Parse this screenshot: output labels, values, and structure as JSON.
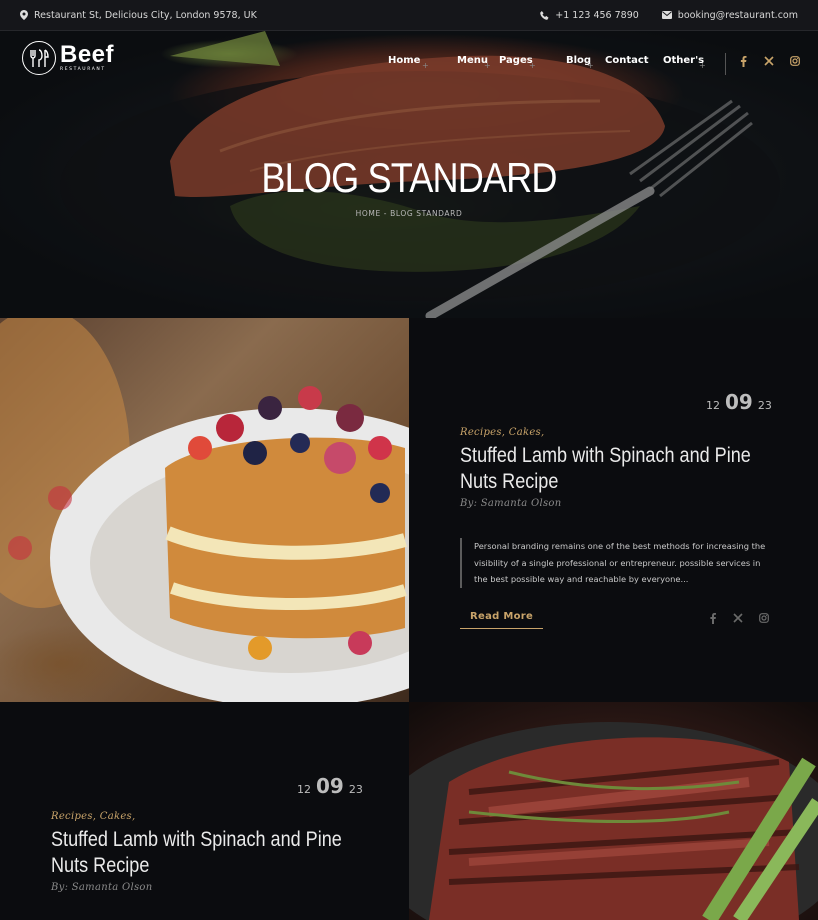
{
  "topbar": {
    "address": "Restaurant St, Delicious City, London 9578, UK",
    "phone": "+1 123 456 7890",
    "email": "booking@restaurant.com",
    "icons": [
      "map-pin-icon",
      "phone-icon",
      "mail-icon"
    ]
  },
  "logo": {
    "brand": "Beef",
    "sub": "RESTAURANT"
  },
  "nav": [
    {
      "label": "Home"
    },
    {
      "label": "Menu"
    },
    {
      "label": "Pages"
    },
    {
      "label": "Blog"
    },
    {
      "label": "Contact"
    },
    {
      "label": "Other's"
    }
  ],
  "social": [
    "facebook-icon",
    "x-icon",
    "instagram-icon"
  ],
  "hero": {
    "title": "BLOG STANDARD",
    "breadcrumb": "HOME - BLOG STANDARD"
  },
  "posts": [
    {
      "day": "12",
      "month": "09",
      "year": "23",
      "categories": "Recipes,  Cakes,",
      "title": "Stuffed Lamb with Spinach and Pine Nuts Recipe",
      "author": "By: Samanta Olson",
      "excerpt": "Personal branding remains one of the best methods for increasing the visibility of a single professional or entrepreneur. possible services in the best possible way and reachable by everyone...",
      "read_more": "Read More"
    },
    {
      "day": "12",
      "month": "09",
      "year": "23",
      "categories": "Recipes,  Cakes,",
      "title": "Stuffed Lamb with Spinach and Pine Nuts Recipe",
      "author": "By: Samanta Olson"
    }
  ],
  "colors": {
    "accent": "#c9a46a",
    "background": "#0b0c0f",
    "topbar": "#15161a"
  }
}
